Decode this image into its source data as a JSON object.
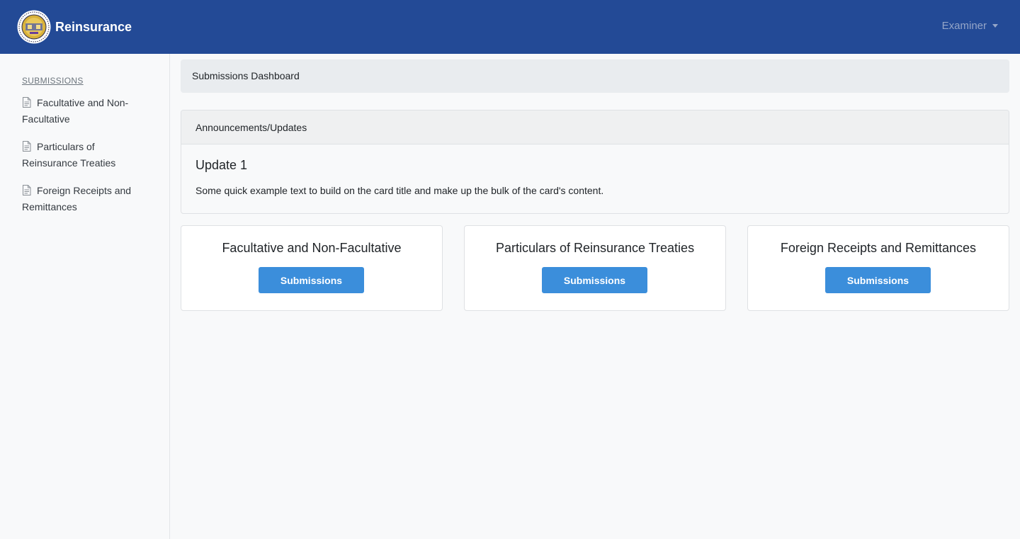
{
  "navbar": {
    "brand": "Reinsurance",
    "user_menu_label": "Examiner",
    "colors": {
      "background": "#234a96",
      "user_menu": "#95a6c8"
    }
  },
  "sidebar": {
    "heading": "SUBMISSIONS",
    "items": [
      {
        "label": "Facultative and Non-Facultative",
        "icon": "document-icon"
      },
      {
        "label": "Particulars of Reinsurance Treaties",
        "icon": "document-icon"
      },
      {
        "label": "Foreign Receipts and Remittances",
        "icon": "document-icon"
      }
    ]
  },
  "breadcrumb": {
    "current": "Submissions Dashboard"
  },
  "announcements": {
    "header": "Announcements/Updates",
    "title": "Update 1",
    "text": "Some quick example text to build on the card title and make up the bulk of the card's content."
  },
  "cards": [
    {
      "title": "Facultative and Non-Facultative",
      "button": "Submissions"
    },
    {
      "title": "Particulars of Reinsurance Treaties",
      "button": "Submissions"
    },
    {
      "title": "Foreign Receipts and Remittances",
      "button": "Submissions"
    }
  ],
  "colors": {
    "button": "#3b8edb"
  }
}
